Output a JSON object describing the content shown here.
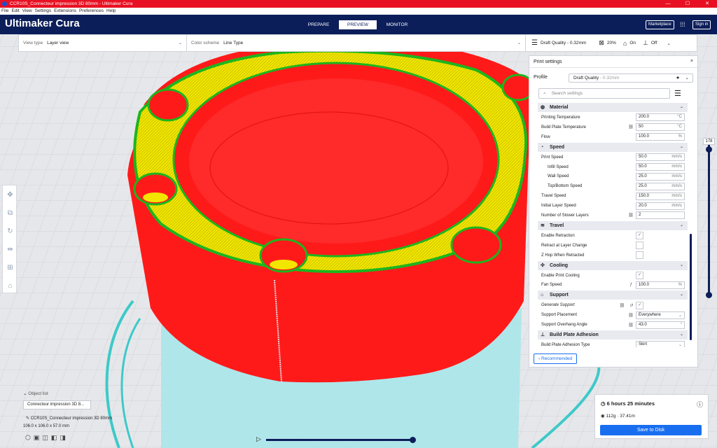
{
  "window": {
    "title": "CCR10S_Connecteur impression 3D 80mm - Ultimaker Cura",
    "controls": [
      "—",
      "☐",
      "✕"
    ]
  },
  "menu": [
    "File",
    "Edit",
    "View",
    "Settings",
    "Extensions",
    "Preferences",
    "Help"
  ],
  "header": {
    "logo": "Ultimaker Cura",
    "stages": [
      "PREPARE",
      "PREVIEW",
      "MONITOR"
    ],
    "marketplace": "Marketplace",
    "signin": "Sign in"
  },
  "toolbar": {
    "view_type_label": "View type",
    "view_type_value": "Layer view",
    "color_scheme_label": "Color scheme",
    "color_scheme_value": "Line Type",
    "quality": "Draft Quality - 0.32mm",
    "infill": "20%",
    "support": "On",
    "adhesion": "Off"
  },
  "panel": {
    "title": "Print settings",
    "profile_label": "Profile",
    "profile_value": "Draft Quality",
    "profile_sub": "- 0.32mm",
    "search_placeholder": "Search settings",
    "material": {
      "title": "Material",
      "rows": [
        {
          "label": "Printing Temperature",
          "value": "200.0",
          "unit": "°C"
        },
        {
          "label": "Build Plate Temperature",
          "value": "50",
          "unit": "°C"
        },
        {
          "label": "Flow",
          "value": "100.0",
          "unit": "%"
        }
      ]
    },
    "speed": {
      "title": "Speed",
      "rows": [
        {
          "label": "Print Speed",
          "value": "50.0",
          "unit": "mm/s"
        },
        {
          "label": "Infill Speed",
          "value": "50.0",
          "unit": "mm/s"
        },
        {
          "label": "Wall Speed",
          "value": "25.0",
          "unit": "mm/s"
        },
        {
          "label": "Top/Bottom Speed",
          "value": "25.0",
          "unit": "mm/s"
        },
        {
          "label": "Travel Speed",
          "value": "150.0",
          "unit": "mm/s"
        },
        {
          "label": "Initial Layer Speed",
          "value": "20.0",
          "unit": "mm/s"
        },
        {
          "label": "Number of Slower Layers",
          "value": "2",
          "unit": ""
        }
      ]
    },
    "travel": {
      "title": "Travel",
      "rows": [
        {
          "label": "Enable Retraction",
          "checked": "✓"
        },
        {
          "label": "Retract at Layer Change",
          "checked": ""
        },
        {
          "label": "Z Hop When Retracted",
          "checked": ""
        }
      ]
    },
    "cooling": {
      "title": "Cooling",
      "rows": [
        {
          "label": "Enable Print Cooling",
          "checked": "✓"
        },
        {
          "label": "Fan Speed",
          "value": "100.0",
          "unit": "%"
        }
      ]
    },
    "support": {
      "title": "Support",
      "rows": [
        {
          "label": "Generate Support",
          "checked": "✓"
        },
        {
          "label": "Support Placement",
          "value": "Everywhere",
          "unit": "⌄"
        },
        {
          "label": "Support Overhang Angle",
          "value": "43.0",
          "unit": "°"
        }
      ]
    },
    "adhesion": {
      "title": "Build Plate Adhesion",
      "rows": [
        {
          "label": "Build Plate Adhesion Type",
          "value": "Skirt",
          "unit": "⌄"
        }
      ]
    },
    "recommended": "Recommended"
  },
  "layer_slider": {
    "value": "178"
  },
  "object_list": {
    "title": "Object list",
    "item": "Connecteur impression 3D 8...",
    "filename": "CCR10S_Connecteur impression 3D 80mm",
    "dims": "106.0 x 106.0 x 57.0 mm"
  },
  "output": {
    "time": "6 hours 25 minutes",
    "weight": "112g · 37.41m",
    "save": "Save to Disk"
  },
  "colors": {
    "header": "#0c1e5a",
    "accent": "#196ef0",
    "titlebar": "#e81123",
    "wall": "#ff0000",
    "infill": "#f0e000",
    "inner_wall": "#00d000",
    "support": "#5cd8d8"
  }
}
